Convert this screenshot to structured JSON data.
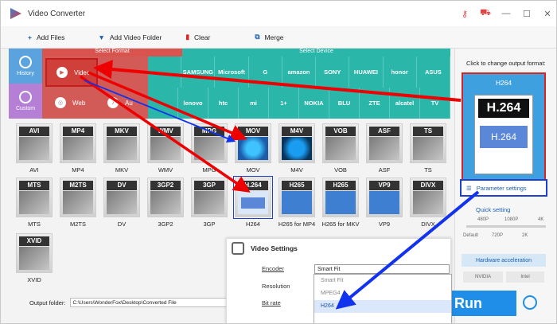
{
  "window": {
    "title": "Video Converter"
  },
  "toolbar": {
    "add_files": "Add Files",
    "add_video_folder": "Add Video Folder",
    "clear": "Clear",
    "merge": "Merge"
  },
  "sections": {
    "select_format": "Select Format",
    "select_device": "Select Device"
  },
  "side": {
    "history": "History",
    "custom": "Custom"
  },
  "categories": {
    "video": "Video",
    "web": "Web",
    "audio": "Au"
  },
  "brands_row1": [
    "",
    "SAMSUNG",
    "Microsoft",
    "G",
    "amazon",
    "SONY",
    "HUAWEI",
    "honor",
    "ASUS"
  ],
  "brands_row2": [
    "",
    "lenovo",
    "htc",
    "mi",
    "1+",
    "NOKIA",
    "BLU",
    "ZTE",
    "alcatel",
    "TV"
  ],
  "formats_row1": [
    {
      "tag": "AVI",
      "label": "AVI"
    },
    {
      "tag": "MP4",
      "label": "MP4"
    },
    {
      "tag": "MKV",
      "label": "MKV"
    },
    {
      "tag": "WMV",
      "label": "WMV"
    },
    {
      "tag": "MPG",
      "label": "MPG"
    },
    {
      "tag": "MOV",
      "label": "MOV"
    },
    {
      "tag": "M4V",
      "label": "M4V"
    },
    {
      "tag": "VOB",
      "label": "VOB"
    },
    {
      "tag": "ASF",
      "label": "ASF"
    },
    {
      "tag": "TS",
      "label": "TS"
    }
  ],
  "formats_row2": [
    {
      "tag": "MTS",
      "label": "MTS"
    },
    {
      "tag": "M2TS",
      "label": "M2TS"
    },
    {
      "tag": "DV",
      "label": "DV"
    },
    {
      "tag": "3GP2",
      "label": "3GP2"
    },
    {
      "tag": "3GP",
      "label": "3GP"
    },
    {
      "tag": "H.264",
      "label": "H264"
    },
    {
      "tag": "H265",
      "label": "H265 for MP4"
    },
    {
      "tag": "H265",
      "label": "H265 for MKV"
    },
    {
      "tag": "VP9",
      "label": "VP9"
    },
    {
      "tag": "DIVX",
      "label": "DIVX"
    }
  ],
  "formats_row3": [
    {
      "tag": "XVID",
      "label": "XVID"
    }
  ],
  "right": {
    "click_text": "Click to change output format:",
    "output_format": "H264",
    "big_tag": "H.264",
    "big_sub": "H.264",
    "parameter_settings": "Parameter settings",
    "quick_setting": "Quick setting",
    "q_top": [
      "480P",
      "1080P",
      "4K"
    ],
    "q_bottom": [
      "Default",
      "720P",
      "2K"
    ],
    "hardware": "Hardware acceleration",
    "nvidia": "NVIDIA",
    "intel": "Intel"
  },
  "output": {
    "label": "Output folder:",
    "path": "C:\\Users\\WonderFox\\Desktop\\Converted File"
  },
  "run": "Run",
  "video_settings": {
    "title": "Video Settings",
    "encoder": "Encoder",
    "resolution": "Resolution",
    "bitrate": "Bit rate",
    "encoder_value": "Smart Fit",
    "options": [
      "Smart Fit",
      "MPEG4",
      "H264"
    ]
  }
}
